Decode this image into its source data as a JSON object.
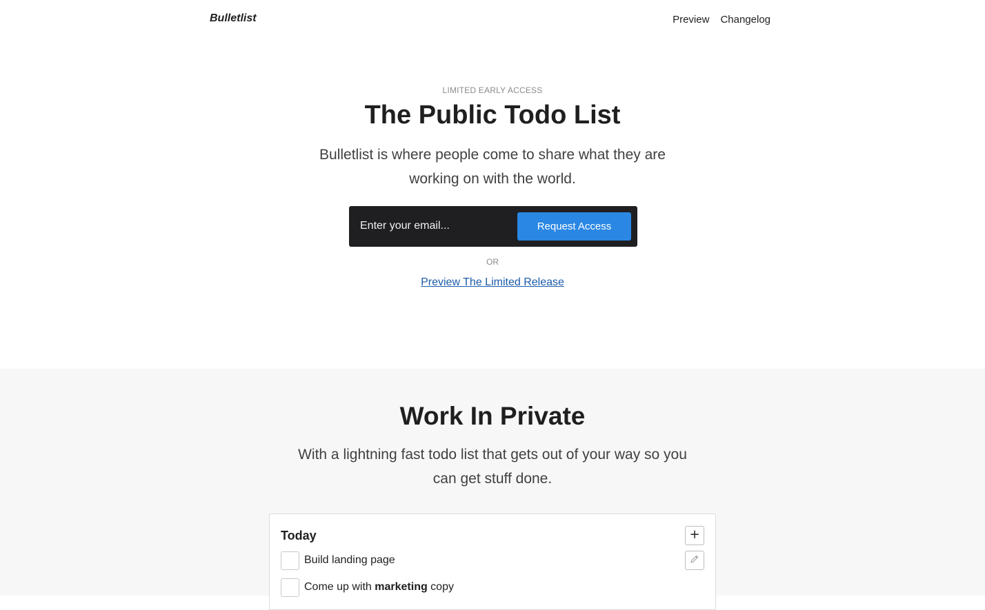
{
  "nav": {
    "brand": "Bulletlist",
    "links": [
      "Preview",
      "Changelog"
    ]
  },
  "hero": {
    "eyebrow": "LIMITED EARLY ACCESS",
    "title": "The Public Todo List",
    "subtitle": "Bulletlist is where people come to share what they are working on with the world.",
    "email_placeholder": "Enter your email...",
    "email_value": "",
    "request_button": "Request Access",
    "or_text": "OR",
    "preview_link": "Preview The Limited Release"
  },
  "section2": {
    "title": "Work In Private",
    "subtitle": "With a lightning fast todo list that gets out of your way so you can get stuff done.",
    "card": {
      "title": "Today",
      "add_icon": "plus-icon",
      "edit_icon": "pencil-icon",
      "todos": [
        {
          "pre": "Build landing page",
          "bold": "",
          "post": ""
        },
        {
          "pre": "Come up with ",
          "bold": "marketing",
          "post": " copy"
        }
      ]
    }
  },
  "colors": {
    "accent": "#2a87e4",
    "signup_bg": "#1f1f22",
    "link": "#1a5aa8",
    "section_bg": "#f7f7f7"
  }
}
